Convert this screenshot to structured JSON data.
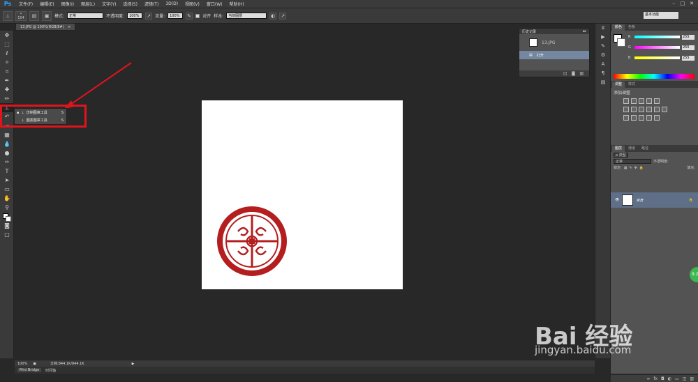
{
  "app": {
    "logo": "Ps",
    "title": "Adobe Photoshop"
  },
  "menu": [
    "文件(F)",
    "编辑(E)",
    "图像(I)",
    "图层(L)",
    "文字(Y)",
    "选择(S)",
    "滤镜(T)",
    "3D(D)",
    "视图(V)",
    "窗口(W)",
    "帮助(H)"
  ],
  "options": {
    "brush_size": "154",
    "mode_label": "模式:",
    "mode_value": "正常",
    "opacity_label": "不透明度:",
    "opacity_value": "100%",
    "flow_label": "流量:",
    "flow_value": "100%",
    "aligned_label": "对齐",
    "sample_label": "样本:",
    "sample_value": "当前图层",
    "workspace": "基本功能"
  },
  "document": {
    "tab_title": "13.JPG @ 100%(RGB/8#)",
    "close": "×"
  },
  "flyout": {
    "items": [
      {
        "label": "仿制图章工具",
        "key": "S"
      },
      {
        "label": "图案图章工具",
        "key": "S"
      }
    ]
  },
  "history": {
    "title": "历史记录",
    "snapshot": "13.JPG",
    "step": "打开"
  },
  "color": {
    "tabs": [
      "颜色",
      "色板"
    ],
    "channels": [
      {
        "name": "R",
        "value": "255",
        "gradient": "#f00"
      },
      {
        "name": "G",
        "value": "255",
        "gradient": "#0f0"
      },
      {
        "name": "B",
        "value": "255",
        "gradient": "#00f"
      }
    ]
  },
  "adjustments": {
    "tabs": [
      "调整",
      "样式"
    ],
    "title": "添加调整"
  },
  "layers": {
    "tabs": [
      "图层",
      "通道",
      "路径"
    ],
    "filter_label": "ρ 类型",
    "blend_mode": "正常",
    "opacity_label": "不透明度:",
    "lock_label": "锁定:",
    "fill_label": "填充:",
    "layer_name": "背景"
  },
  "status": {
    "zoom": "100%",
    "doc_info": "文档:844.1K/844.1K"
  },
  "bridge": {
    "tabs": [
      "Mini Bridge",
      "时间轴"
    ]
  },
  "floating_badge": "9.2",
  "watermark": {
    "logo": "Bai 经验",
    "url": "jingyan.baidu.com"
  },
  "colors": {
    "seal_red": "#b41e1e",
    "annotation_red": "#e1141c",
    "selection_blue": "#7487a0"
  }
}
